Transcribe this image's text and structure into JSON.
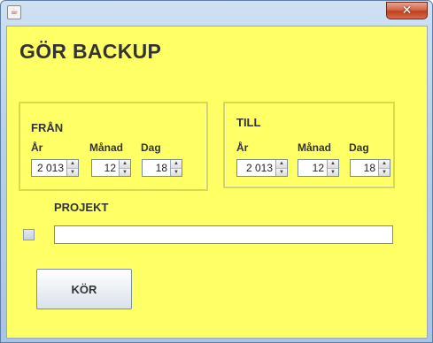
{
  "window": {
    "title_icon": "java-cup-icon",
    "close_glyph": "✕"
  },
  "heading": "GÖR BACKUP",
  "from": {
    "title": "FRÅN",
    "year_label": "År",
    "month_label": "Månad",
    "day_label": "Dag",
    "year": "2 013",
    "month": "12",
    "day": "18"
  },
  "to": {
    "title": "TILL",
    "year_label": "År",
    "month_label": "Månad",
    "day_label": "Dag",
    "year": "2 013",
    "month": "12",
    "day": "18"
  },
  "project": {
    "label": "PROJEKT",
    "checked": false,
    "value": ""
  },
  "run_button": "KÖR",
  "spinner_glyphs": {
    "up": "▲",
    "down": "▼"
  },
  "colors": {
    "background": "#ffff66",
    "panel_border": "#d9d94a"
  }
}
